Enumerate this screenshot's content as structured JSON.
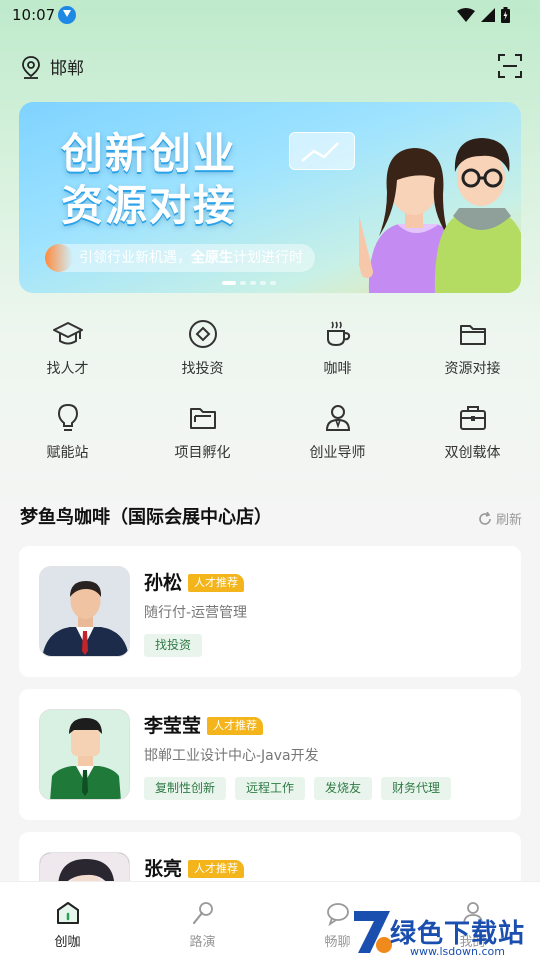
{
  "status": {
    "time": "10:07"
  },
  "location": {
    "city": "邯郸"
  },
  "banner": {
    "title_line1": "创新创业",
    "title_line2": "资源对接",
    "subtitle_prefix": "引领行业新机遇，",
    "subtitle_bold": "全原生",
    "subtitle_suffix": "计划进行时"
  },
  "features": [
    {
      "label": "找人才",
      "icon": "graduation-cap-icon"
    },
    {
      "label": "找投资",
      "icon": "coin-icon"
    },
    {
      "label": "咖啡",
      "icon": "coffee-icon"
    },
    {
      "label": "资源对接",
      "icon": "folder-icon"
    },
    {
      "label": "赋能站",
      "icon": "lightbulb-icon"
    },
    {
      "label": "项目孵化",
      "icon": "open-folder-icon"
    },
    {
      "label": "创业导师",
      "icon": "mentor-icon"
    },
    {
      "label": "双创载体",
      "icon": "briefcase-icon"
    }
  ],
  "section": {
    "title": "梦鱼鸟咖啡（国际会展中心店）",
    "refresh": "刷新"
  },
  "people": [
    {
      "name": "孙松",
      "badge": "人才推荐",
      "role": "随行付-运营管理",
      "tags": [
        "找投资"
      ]
    },
    {
      "name": "李莹莹",
      "badge": "人才推荐",
      "role": "邯郸工业设计中心-Java开发",
      "tags": [
        "复制性创新",
        "远程工作",
        "发烧友",
        "财务代理"
      ]
    },
    {
      "name": "张亮",
      "badge": "人才推荐",
      "role": "",
      "tags": []
    }
  ],
  "nav": [
    {
      "label": "创咖",
      "icon": "home-icon",
      "active": true
    },
    {
      "label": "路演",
      "icon": "microphone-icon",
      "active": false
    },
    {
      "label": "畅聊",
      "icon": "chat-icon",
      "active": false
    },
    {
      "label": "我的",
      "icon": "profile-icon",
      "active": false
    }
  ],
  "watermark": {
    "text": "绿色下载站",
    "url": "www.lsdown.com"
  }
}
